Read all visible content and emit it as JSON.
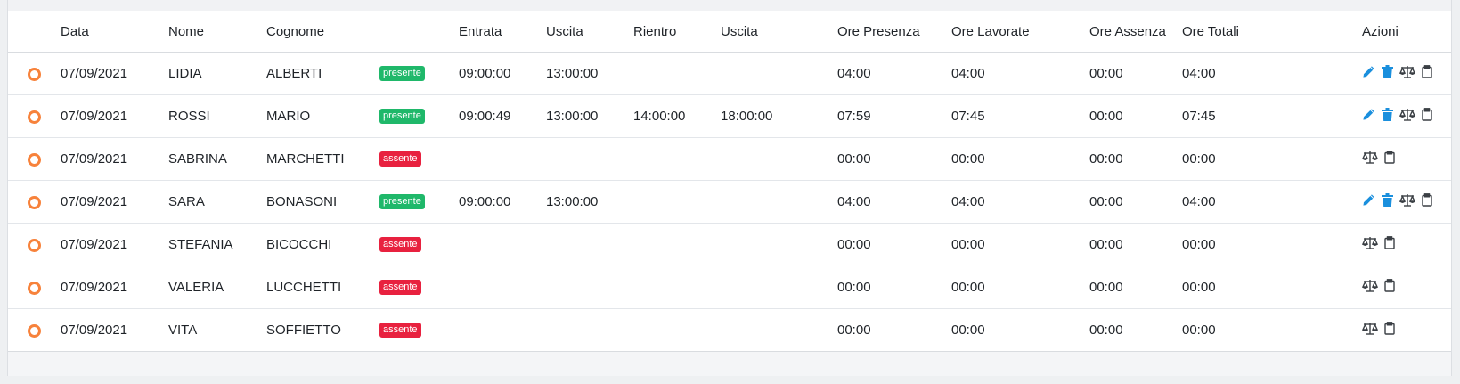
{
  "table": {
    "headers": [
      "Data",
      "Nome",
      "Cognome",
      "Entrata",
      "Uscita",
      "Rientro",
      "Uscita",
      "Ore Presenza",
      "Ore Lavorate",
      "Ore Assenza",
      "Ore Totali",
      "Azioni"
    ],
    "rows": [
      {
        "data": "07/09/2021",
        "nome": "LIDIA",
        "cognome": "ALBERTI",
        "stato": "presente",
        "entrata": "09:00:00",
        "uscita": "13:00:00",
        "rientro": "",
        "uscita2": "",
        "ore_presenza": "04:00",
        "ore_lavorate": "04:00",
        "ore_assenza": "00:00",
        "ore_totali": "04:00",
        "actions": [
          "edit",
          "delete",
          "balance",
          "clipboard"
        ]
      },
      {
        "data": "07/09/2021",
        "nome": "ROSSI",
        "cognome": "MARIO",
        "stato": "presente",
        "entrata": "09:00:49",
        "uscita": "13:00:00",
        "rientro": "14:00:00",
        "uscita2": "18:00:00",
        "ore_presenza": "07:59",
        "ore_lavorate": "07:45",
        "ore_assenza": "00:00",
        "ore_totali": "07:45",
        "actions": [
          "edit",
          "delete",
          "balance",
          "clipboard"
        ]
      },
      {
        "data": "07/09/2021",
        "nome": "SABRINA",
        "cognome": "MARCHETTI",
        "stato": "assente",
        "entrata": "",
        "uscita": "",
        "rientro": "",
        "uscita2": "",
        "ore_presenza": "00:00",
        "ore_lavorate": "00:00",
        "ore_assenza": "00:00",
        "ore_totali": "00:00",
        "actions": [
          "balance",
          "clipboard"
        ]
      },
      {
        "data": "07/09/2021",
        "nome": "SARA",
        "cognome": "BONASONI",
        "stato": "presente",
        "entrata": "09:00:00",
        "uscita": "13:00:00",
        "rientro": "",
        "uscita2": "",
        "ore_presenza": "04:00",
        "ore_lavorate": "04:00",
        "ore_assenza": "00:00",
        "ore_totali": "04:00",
        "actions": [
          "edit",
          "delete",
          "balance",
          "clipboard"
        ]
      },
      {
        "data": "07/09/2021",
        "nome": "STEFANIA",
        "cognome": "BICOCCHI",
        "stato": "assente",
        "entrata": "",
        "uscita": "",
        "rientro": "",
        "uscita2": "",
        "ore_presenza": "00:00",
        "ore_lavorate": "00:00",
        "ore_assenza": "00:00",
        "ore_totali": "00:00",
        "actions": [
          "balance",
          "clipboard"
        ]
      },
      {
        "data": "07/09/2021",
        "nome": "VALERIA",
        "cognome": "LUCCHETTI",
        "stato": "assente",
        "entrata": "",
        "uscita": "",
        "rientro": "",
        "uscita2": "",
        "ore_presenza": "00:00",
        "ore_lavorate": "00:00",
        "ore_assenza": "00:00",
        "ore_totali": "00:00",
        "actions": [
          "balance",
          "clipboard"
        ]
      },
      {
        "data": "07/09/2021",
        "nome": "VITA",
        "cognome": "SOFFIETTO",
        "stato": "assente",
        "entrata": "",
        "uscita": "",
        "rientro": "",
        "uscita2": "",
        "ore_presenza": "00:00",
        "ore_lavorate": "00:00",
        "ore_assenza": "00:00",
        "ore_totali": "00:00",
        "actions": [
          "balance",
          "clipboard"
        ]
      }
    ]
  },
  "colors": {
    "present": "#1fb86a",
    "absent": "#e8213f",
    "status_dot": "#f7823b",
    "action_blue": "#1a8fdd",
    "action_gray": "#3a3f44"
  },
  "icons": {
    "status": "status-dot-icon",
    "edit": "pencil-icon",
    "delete": "trash-icon",
    "balance": "balance-scale-icon",
    "clipboard": "clipboard-icon"
  }
}
